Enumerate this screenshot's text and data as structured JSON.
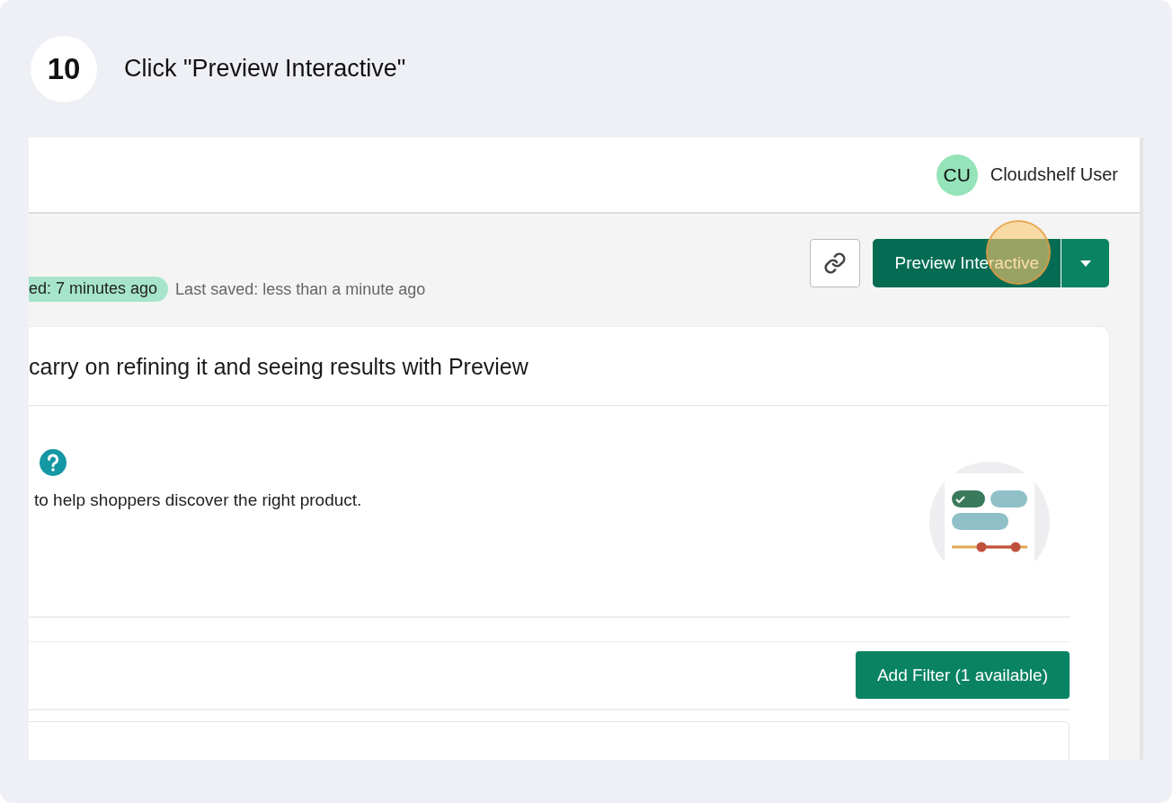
{
  "step": {
    "number": "10",
    "instruction": "Click \"Preview Interactive\""
  },
  "header": {
    "avatar": "CU",
    "user_name": "Cloudshelf User"
  },
  "toolbar": {
    "primary_button": "Preview Interactive",
    "published_badge": "ed: 7 minutes ago",
    "last_saved": "Last saved: less than a minute ago"
  },
  "card": {
    "title": "carry on refining it and seeing results with Preview",
    "description": "to help shoppers discover the right product."
  },
  "filters": {
    "add_button": "Add Filter (1 available)"
  }
}
